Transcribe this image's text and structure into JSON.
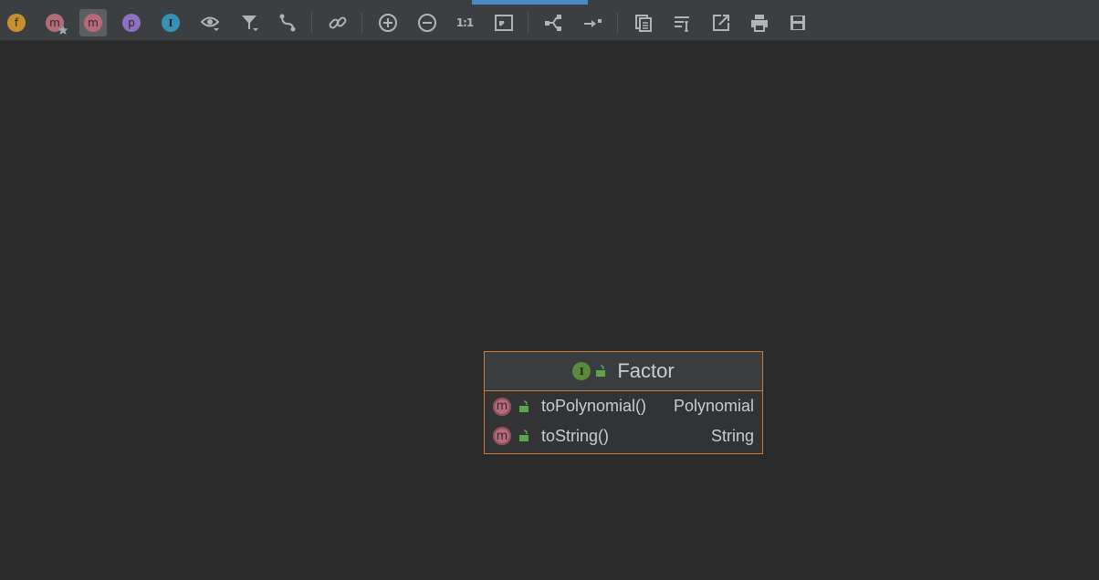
{
  "toolbar": {
    "fields_badge": "f",
    "constructors_badge": "m",
    "methods_badge": "m",
    "properties_badge": "p",
    "inner_classes_badge": "I",
    "actual_size_label": "1:1",
    "icons": [
      "show-fields-icon",
      "show-constructors-icon",
      "show-methods-icon",
      "show-properties-icon",
      "show-inner-classes-icon",
      "eye-icon",
      "filter-icon",
      "edge-routing-icon",
      "link-icon",
      "zoom-in-icon",
      "zoom-out-icon",
      "actual-size-icon",
      "fit-content-icon",
      "layout-icon",
      "apply-layout-icon",
      "copy-icon",
      "align-icon",
      "export-icon",
      "print-icon",
      "save-icon"
    ]
  },
  "diagram": {
    "class_node": {
      "kind_badge": "I",
      "name": "Factor",
      "members": [
        {
          "badge": "m",
          "name": "toPolynomial()",
          "type": "Polynomial"
        },
        {
          "badge": "m",
          "name": "toString()",
          "type": "String"
        }
      ]
    }
  },
  "colors": {
    "background": "#2b2b2b",
    "toolbar": "#3c3f41",
    "node_border": "#c87a3a",
    "interface_badge": "#5a8a3a",
    "method_badge": "#b56b77",
    "accent_tab": "#4a88c7"
  }
}
